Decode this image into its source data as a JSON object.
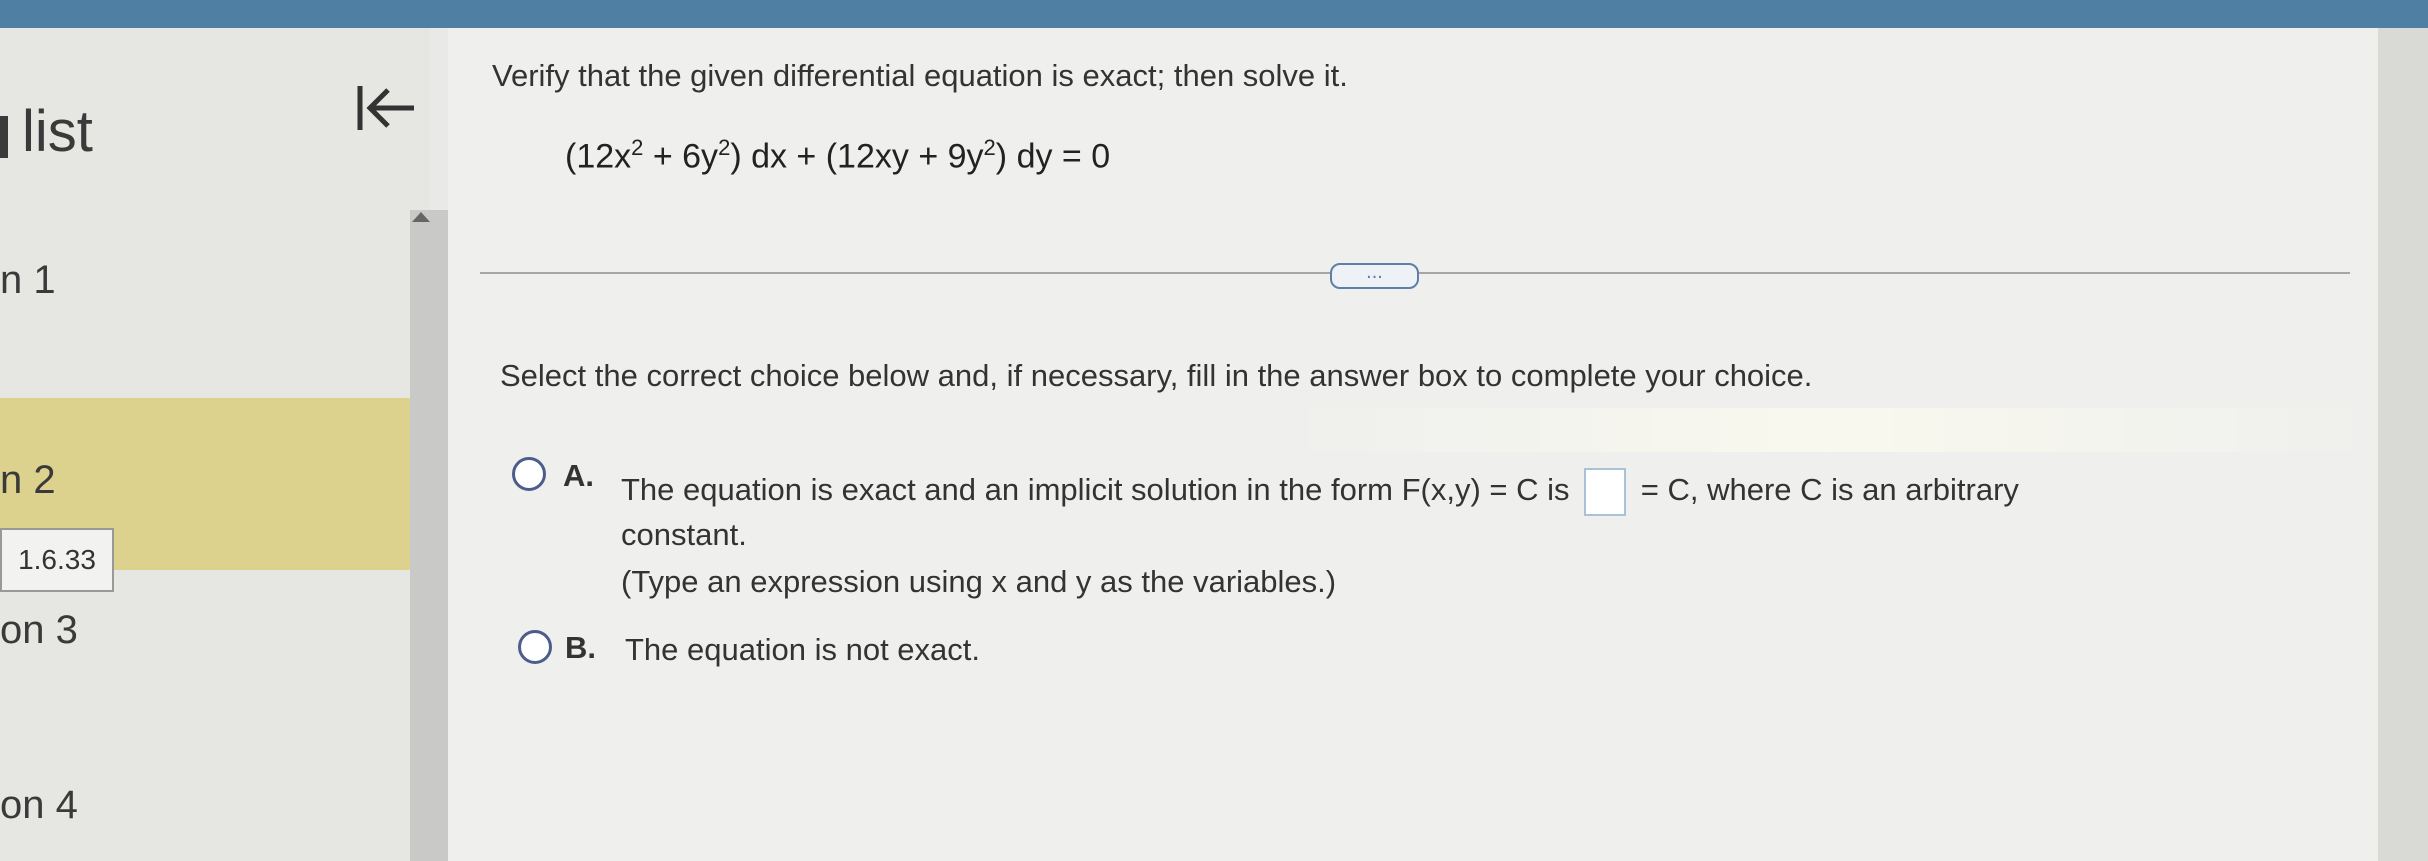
{
  "sidebar": {
    "title": "list",
    "items": [
      {
        "label": "n 1"
      },
      {
        "label": "n 2",
        "badge": "1.6.33"
      },
      {
        "label": "on 3"
      },
      {
        "label": "on 4"
      }
    ]
  },
  "question": {
    "instruction": "Verify that the given differential equation is exact; then solve it.",
    "equation": {
      "p1": "(12x",
      "e1": "2",
      "p2": " + 6y",
      "e2": "2",
      "p3": ") dx + (12xy + 9y",
      "e3": "2",
      "p4": ") dy = 0"
    },
    "more_label": "...",
    "prompt": "Select the correct choice below and, if necessary, fill in the answer box to complete your choice.",
    "choices": [
      {
        "letter": "A.",
        "text_before": "The equation is exact and an implicit solution in the form F(x,y) = C is",
        "text_after": "= C, where C is an arbitrary",
        "line2": "constant.",
        "hint": "(Type an expression using x and y as the variables.)"
      },
      {
        "letter": "B.",
        "text": "The equation is not exact."
      }
    ]
  },
  "colors": {
    "topbar": "#4f7fa3",
    "active_item": "#ddd18e",
    "radio": "#4b5d8b",
    "link": "#5e7fa6"
  }
}
